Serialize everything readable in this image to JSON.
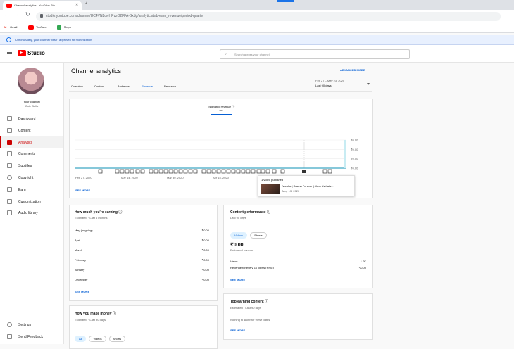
{
  "browser": {
    "tab_title": "Channel analytics - YouTube Stu...",
    "url": "studio.youtube.com/channel/UC4VN2cwHPvzO2FFA-Bxdg/analytics/tab-earn_revenue/period-quarter",
    "bookmarks": [
      {
        "label": "Gmail"
      },
      {
        "label": "YouTube"
      },
      {
        "label": "Maps"
      }
    ]
  },
  "banner": {
    "text": "Unfortunately, your channel wasn't approved for monetization"
  },
  "header": {
    "logo": "Studio",
    "search_placeholder": "Search across your channel"
  },
  "sidebar": {
    "channel_label": "Your channel",
    "channel_name": "Cute Bella",
    "items": [
      {
        "label": "Dashboard",
        "icon": "dashboard-icon"
      },
      {
        "label": "Content",
        "icon": "content-icon"
      },
      {
        "label": "Analytics",
        "icon": "analytics-icon",
        "active": true
      },
      {
        "label": "Comments",
        "icon": "comments-icon"
      },
      {
        "label": "Subtitles",
        "icon": "subtitles-icon"
      },
      {
        "label": "Copyright",
        "icon": "copyright-icon"
      },
      {
        "label": "Earn",
        "icon": "earn-icon"
      },
      {
        "label": "Customization",
        "icon": "customization-icon"
      },
      {
        "label": "Audio library",
        "icon": "audio-library-icon"
      }
    ],
    "bottom_items": [
      {
        "label": "Settings",
        "icon": "settings-icon"
      },
      {
        "label": "Send Feedback",
        "icon": "feedback-icon"
      }
    ]
  },
  "page": {
    "title": "Channel analytics",
    "advanced_mode": "ADVANCED MODE",
    "tabs": [
      "Overview",
      "Content",
      "Audience",
      "Revenue",
      "Research"
    ],
    "active_tab": "Revenue",
    "date_range": "Feb 27 – May 23, 2020",
    "period": "Last 90 days"
  },
  "chart_card": {
    "metric_label": "Estimated revenue",
    "metric_value": "—",
    "see_more": "SEE MORE",
    "tooltip": {
      "count": "1 video published",
      "title": "Varsha | Drama Forever | #love #whats...",
      "date": "May 13, 2020"
    }
  },
  "chart_data": {
    "type": "line",
    "x_tick_labels": [
      "Feb 27, 2020",
      "Mar 14, 2020",
      "Mar 30, 2020",
      "Apr 15, 2020",
      "May 1, 2020"
    ],
    "y_tick_labels": [
      "₹0.00",
      "₹0.00",
      "₹0.00",
      "₹0.00"
    ],
    "series": [
      {
        "values": [
          0,
          0,
          0,
          0,
          0,
          0,
          0,
          0,
          0,
          0,
          0,
          0,
          0
        ]
      }
    ],
    "grid": true
  },
  "earning_card": {
    "title": "How much you're earning",
    "subtitle": "Estimated · Last 6 months",
    "rows": [
      {
        "label": "May (ongoing)",
        "value": "₹0.00"
      },
      {
        "label": "April",
        "value": "₹0.00"
      },
      {
        "label": "March",
        "value": "₹0.00"
      },
      {
        "label": "February",
        "value": "₹0.00"
      },
      {
        "label": "January",
        "value": "₹0.00"
      },
      {
        "label": "December",
        "value": "₹0.00"
      }
    ],
    "see_more": "SEE MORE"
  },
  "money_card": {
    "title": "How you make money",
    "subtitle": "Estimated · Last 90 days",
    "pills": [
      "All",
      "Videos",
      "Shorts"
    ]
  },
  "perf_card": {
    "title": "Content performance",
    "subtitle": "Last 90 days",
    "pills": [
      "Videos",
      "Shorts"
    ],
    "big_value": "₹0.00",
    "big_label": "Estimated revenue",
    "rows": [
      {
        "label": "Views",
        "value": "1.0K"
      },
      {
        "label": "Revenue for every 1k views (RPM)",
        "value": "₹0.00"
      }
    ],
    "see_more": "SEE MORE"
  },
  "top_card": {
    "title": "Top earning content",
    "subtitle": "Estimated · Last 90 days",
    "empty": "Nothing to show for these dates",
    "see_more": "SEE MORE"
  }
}
